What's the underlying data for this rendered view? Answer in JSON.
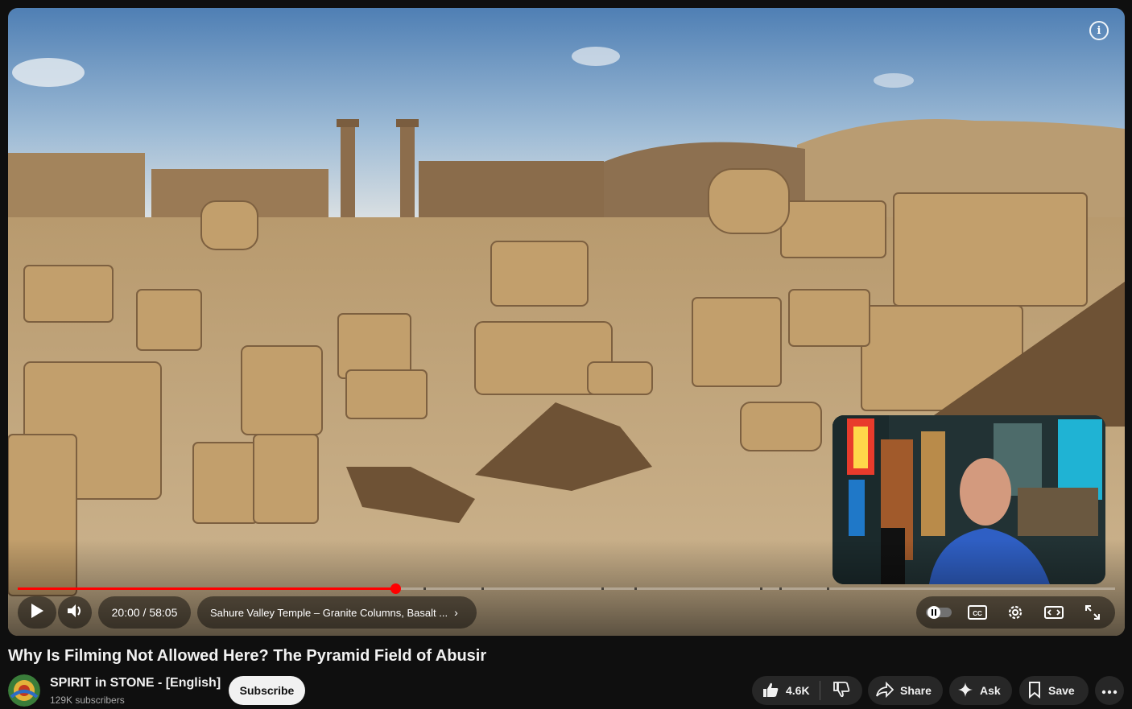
{
  "player": {
    "info_icon": "info-icon",
    "progress": {
      "played_fraction": 0.344,
      "current": "20:00",
      "duration": "58:05"
    },
    "time_display": "20:00 / 58:05",
    "chapter_title": "Sahure Valley Temple – Granite Columns, Basalt ...",
    "accent_color": "#ff0000",
    "controls": {
      "play": "play-icon",
      "volume": "volume-icon",
      "autoplay": "autoplay-toggle-icon",
      "captions": "cc-icon",
      "settings": "gear-icon",
      "theater": "theater-mode-icon",
      "fullscreen": "fullscreen-icon"
    }
  },
  "video": {
    "title": "Why Is Filming Not Allowed Here? The Pyramid Field of Abusir"
  },
  "channel": {
    "name": "SPIRIT in STONE - [English]",
    "subscribers": "129K subscribers",
    "subscribe_label": "Subscribe"
  },
  "actions": {
    "likes": "4.6K",
    "share_label": "Share",
    "ask_label": "Ask",
    "save_label": "Save"
  }
}
